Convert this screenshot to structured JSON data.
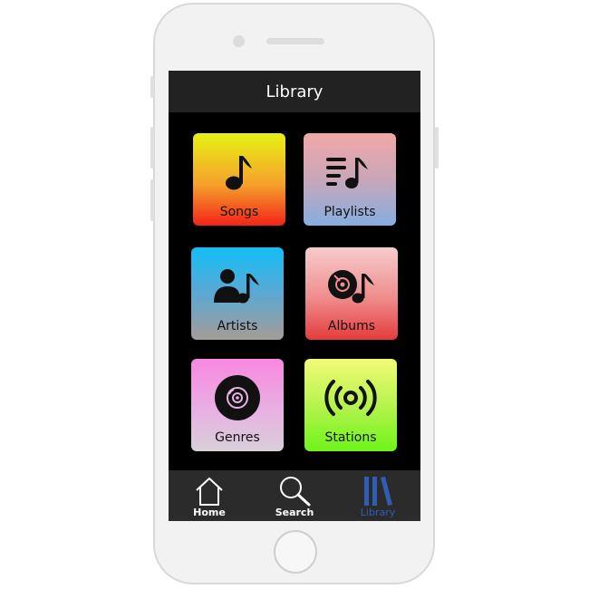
{
  "header": {
    "title": "Library"
  },
  "tiles": [
    {
      "label": "Songs",
      "icon": "music-note-icon"
    },
    {
      "label": "Playlists",
      "icon": "playlist-icon"
    },
    {
      "label": "Artists",
      "icon": "artist-icon"
    },
    {
      "label": "Albums",
      "icon": "album-icon"
    },
    {
      "label": "Genres",
      "icon": "vinyl-record-icon"
    },
    {
      "label": "Stations",
      "icon": "broadcast-icon"
    }
  ],
  "tabbar": {
    "items": [
      {
        "label": "Home",
        "icon": "home-icon"
      },
      {
        "label": "Search",
        "icon": "search-icon"
      },
      {
        "label": "Library",
        "icon": "library-icon",
        "active": true
      }
    ],
    "active_color": "#2f5cb5"
  }
}
